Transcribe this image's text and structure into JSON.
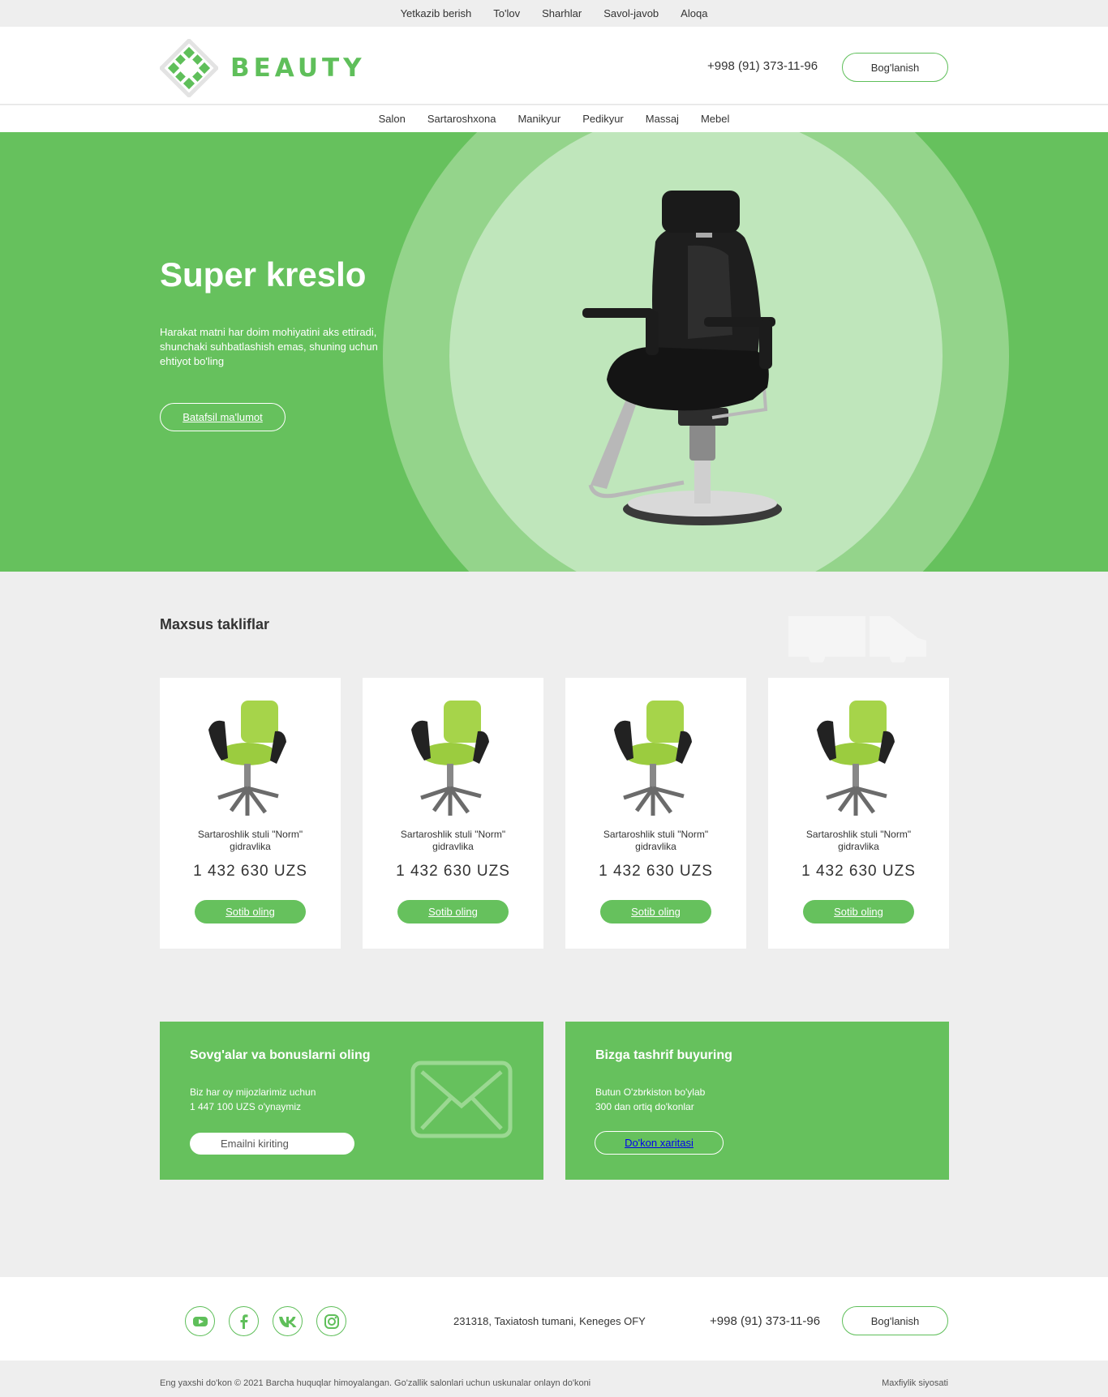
{
  "topnav": [
    "Yetkazib berish",
    "To'lov",
    "Sharhlar",
    "Savol-javob",
    "Aloqa"
  ],
  "brand": {
    "name": "BEAUTY",
    "color": "#5fbf5a"
  },
  "header": {
    "phone": "+998 (91) 373-11-96",
    "contact_button": "Bog'lanish"
  },
  "categories": [
    "Salon",
    "Sartaroshxona",
    "Manikyur",
    "Pedikyur",
    "Massaj",
    "Mebel"
  ],
  "hero": {
    "title": "Super kreslo",
    "text": "Harakat matni har doim mohiyatini aks ettiradi, shunchaki suhbatlashish emas, shuning uchun ehtiyot bo'ling",
    "button": "Batafsil ma'lumot",
    "colors": {
      "background": "#66c15d",
      "ring": "#94d48b",
      "inner": "#bfe6bb"
    }
  },
  "offers": {
    "title": "Maxsus takliflar",
    "products": [
      {
        "name": "Sartaroshlik stuli \"Norm\" gidravlika",
        "price": "1 432 630 UZS",
        "button": "Sotib oling"
      },
      {
        "name": "Sartaroshlik stuli \"Norm\" gidravlika",
        "price": "1 432 630 UZS",
        "button": "Sotib oling"
      },
      {
        "name": "Sartaroshlik stuli \"Norm\" gidravlika",
        "price": "1 432 630 UZS",
        "button": "Sotib oling"
      },
      {
        "name": "Sartaroshlik stuli \"Norm\" gidravlika",
        "price": "1 432 630 UZS",
        "button": "Sotib oling"
      }
    ]
  },
  "promo_left": {
    "title": "Sovg'alar va bonuslarni oling",
    "text_line1": "Biz har oy mijozlarimiz uchun",
    "text_line2": "1 447 100 UZS o'ynaymiz",
    "email_placeholder": "Emailni kiriting"
  },
  "promo_right": {
    "title": "Bizga tashrif buyuring",
    "text_line1": "Butun O'zbrkiston bo'ylab",
    "text_line2": "300 dan ortiq do'konlar",
    "button": "Do'kon xaritasi"
  },
  "footer": {
    "socials": [
      "youtube-icon",
      "facebook-icon",
      "vk-icon",
      "instagram-icon"
    ],
    "address": "231318, Taxiatosh tumani, Keneges OFY",
    "phone": "+998 (91) 373-11-96",
    "contact_button": "Bog'lanish",
    "copyright": "Eng yaxshi do'kon © 2021 Barcha huquqlar himoyalangan. Go'zallik salonlari uchun uskunalar onlayn do'koni",
    "privacy": "Maxfiylik siyosati"
  }
}
